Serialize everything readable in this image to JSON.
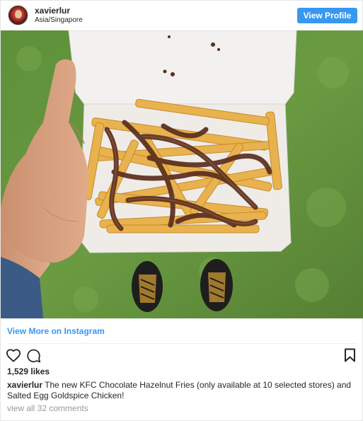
{
  "header": {
    "username": "xavierlur",
    "location": "Asia/Singapore",
    "view_profile_label": "View Profile"
  },
  "post": {
    "view_more_label": "View More on Instagram",
    "likes": "1,529 likes",
    "caption_user": "xavierlur",
    "caption_text": "The new KFC Chocolate Hazelnut Fries (only available at 10 selected stores) and Salted Egg Goldspice Chicken!",
    "comments_link": "view all 32 comments"
  },
  "icons": {
    "like": "heart-icon",
    "comment": "comment-icon",
    "save": "bookmark-icon"
  },
  "colors": {
    "accent": "#3897f0",
    "text": "#262626",
    "muted": "#999999"
  }
}
